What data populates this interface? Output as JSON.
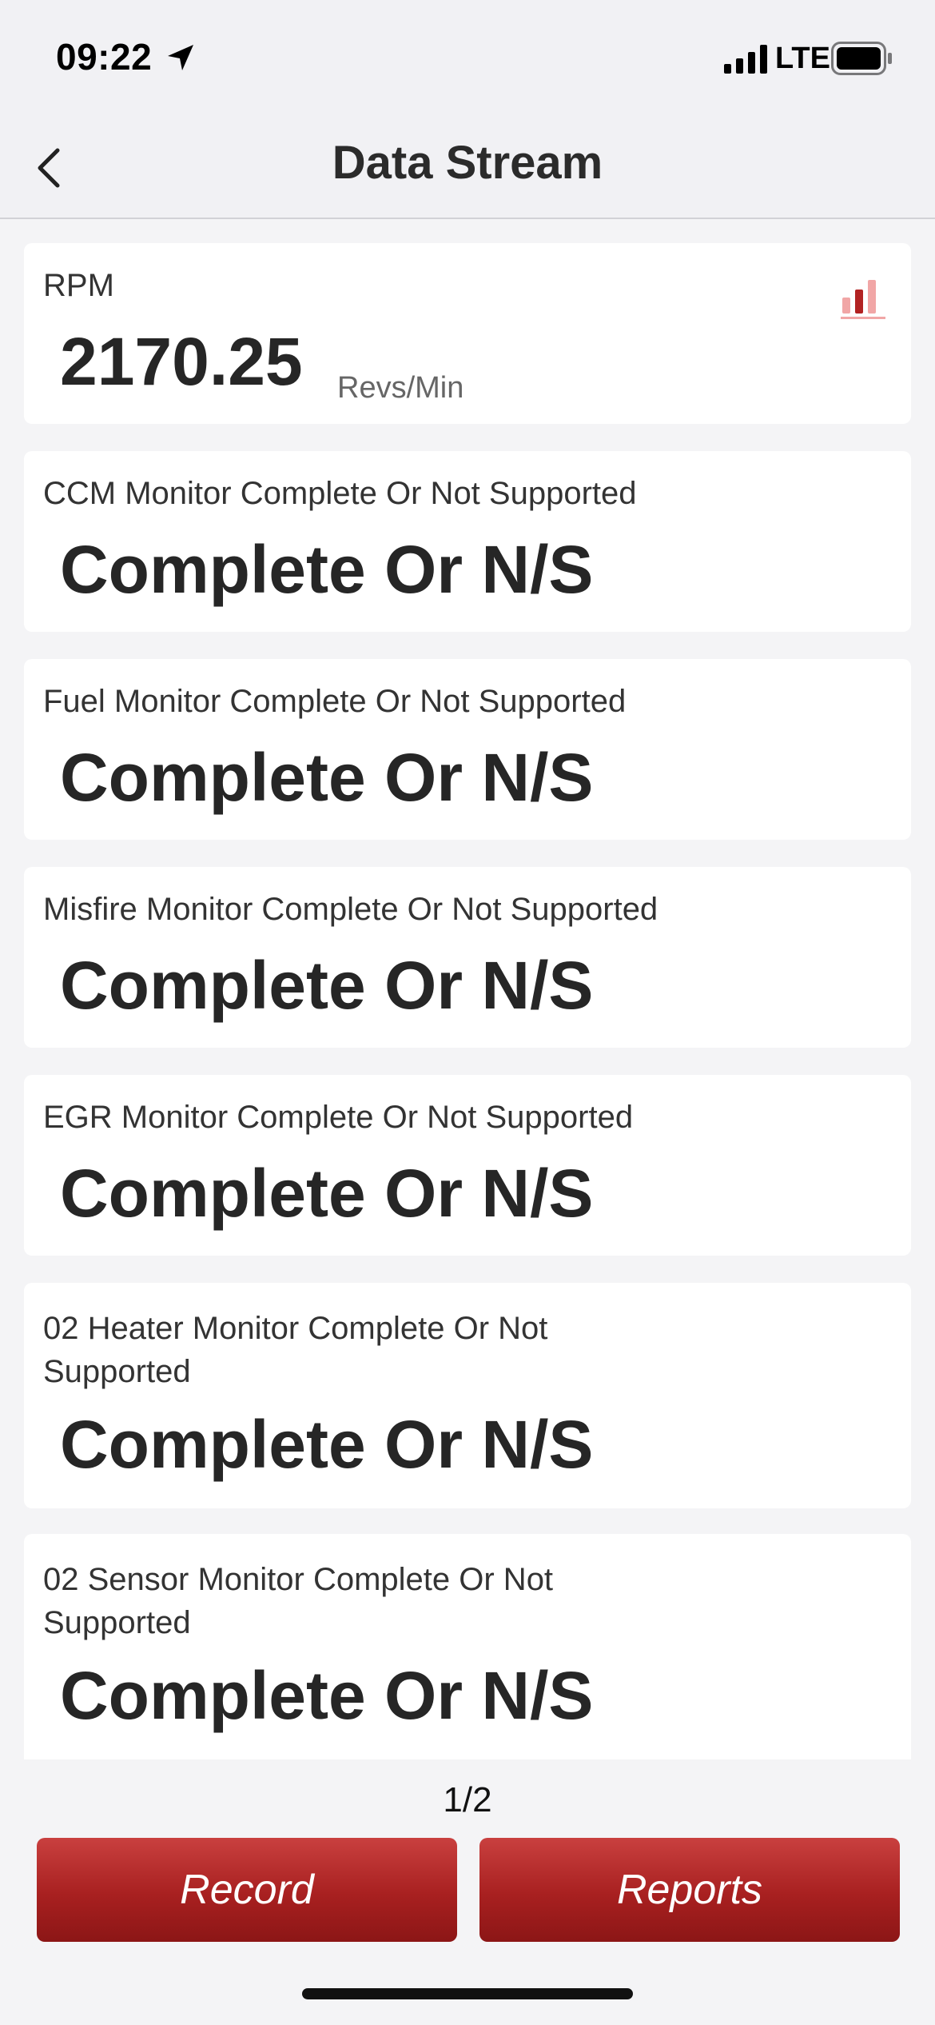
{
  "status_bar": {
    "time": "09:22",
    "network": "LTE",
    "icons": [
      "location-arrow-icon",
      "signal-bars-icon",
      "battery-icon"
    ]
  },
  "nav": {
    "title": "Data Stream",
    "back_icon": "chevron-left-icon"
  },
  "rpm_card": {
    "label": "RPM",
    "value": "2170.25",
    "unit": "Revs/Min",
    "chart_icon": "bar-chart-icon"
  },
  "monitors": [
    {
      "label": "CCM Monitor Complete Or Not Supported",
      "value": "Complete Or N/S"
    },
    {
      "label": "Fuel Monitor Complete Or Not Supported",
      "value": "Complete Or N/S"
    },
    {
      "label": "Misfire Monitor Complete Or Not Supported",
      "value": "Complete Or N/S"
    },
    {
      "label": "EGR Monitor Complete Or Not Supported",
      "value": "Complete Or N/S"
    },
    {
      "label": "02 Heater Monitor Complete Or Not Supported",
      "value": "Complete Or N/S"
    },
    {
      "label": "02 Sensor Monitor Complete Or Not Supported",
      "value": "Complete Or N/S"
    }
  ],
  "footer": {
    "page_indicator": "1/2",
    "record_label": "Record",
    "reports_label": "Reports"
  },
  "colors": {
    "accent_red": "#a82020",
    "background": "#f4f4f6",
    "card": "#ffffff"
  }
}
